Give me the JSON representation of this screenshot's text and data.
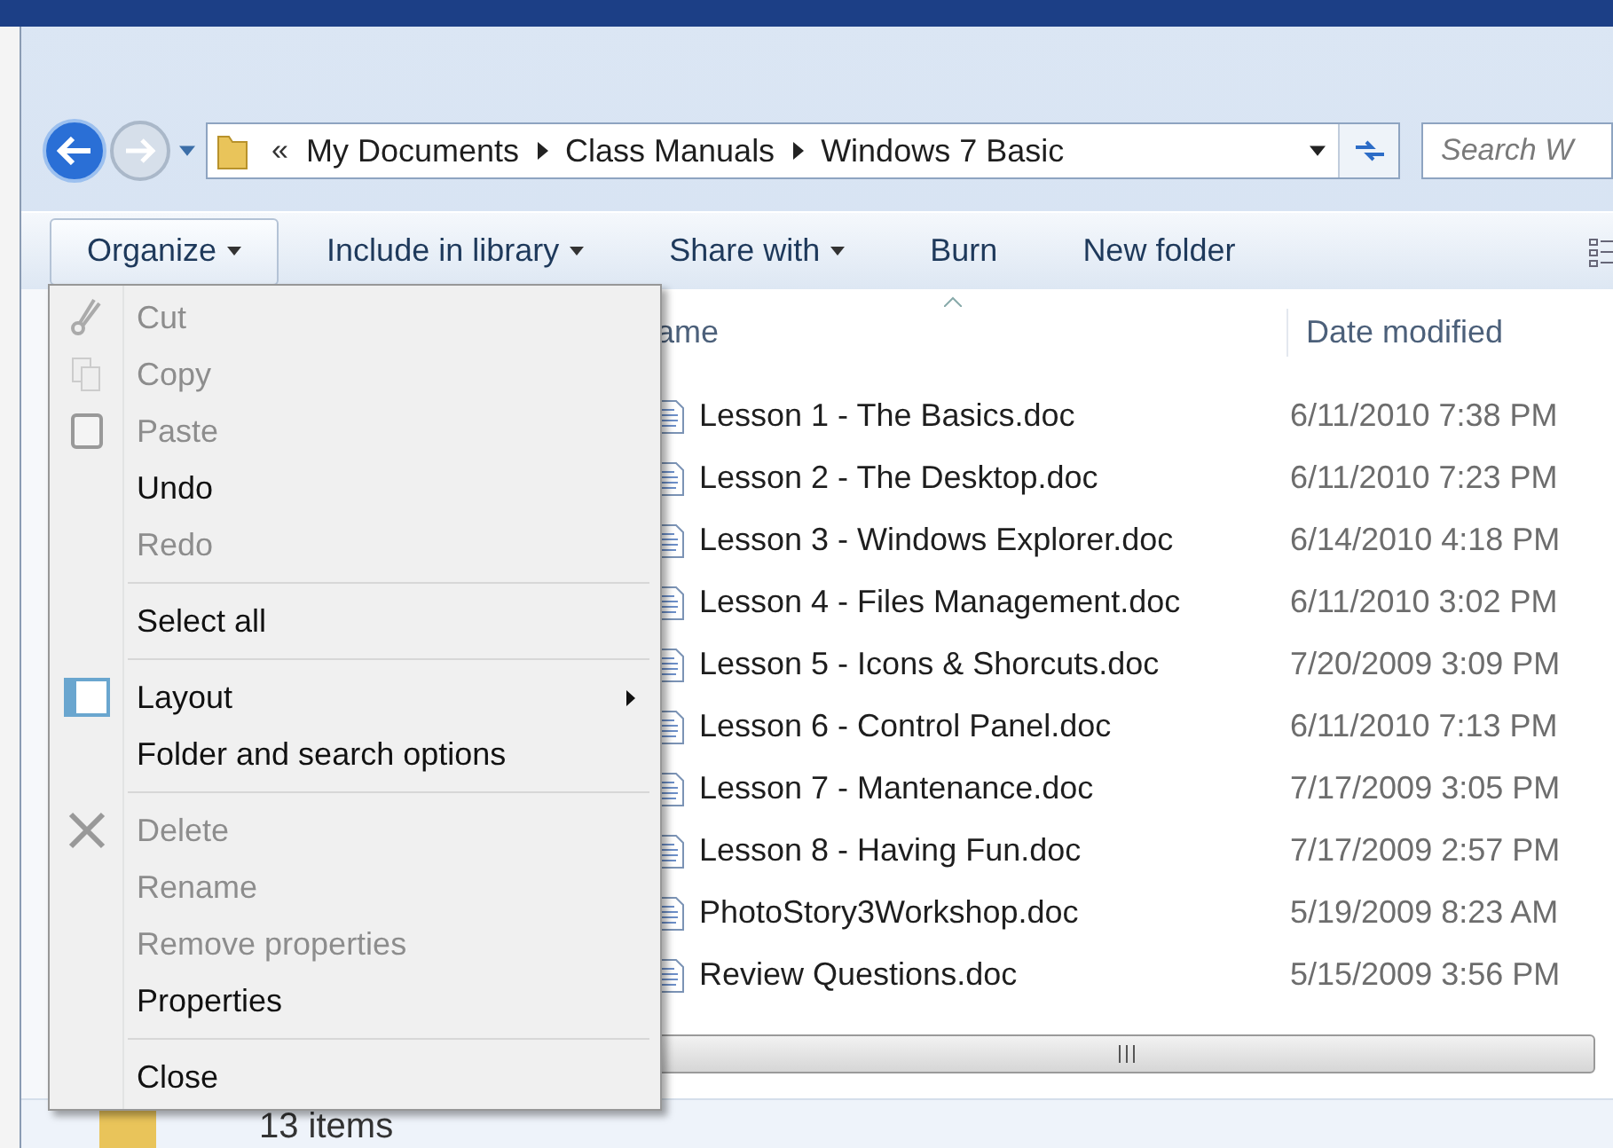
{
  "address_bar": {
    "overflow": "«",
    "path": [
      "My Documents",
      "Class Manuals",
      "Windows 7 Basic"
    ],
    "search": {
      "placeholder": "Search W"
    }
  },
  "toolbar": [
    {
      "label": "Organize",
      "has_menu": true,
      "selected": true
    },
    {
      "label": "Include in library",
      "has_menu": true,
      "selected": false
    },
    {
      "label": "Share with",
      "has_menu": true,
      "selected": false
    },
    {
      "label": "Burn",
      "has_menu": false,
      "selected": false
    },
    {
      "label": "New folder",
      "has_menu": false,
      "selected": false
    }
  ],
  "columns": [
    "ame",
    "Date modified"
  ],
  "files": [
    {
      "name": "Lesson 1 - The Basics.doc",
      "date": "6/11/2010 7:38 PM"
    },
    {
      "name": "Lesson 2 - The Desktop.doc",
      "date": "6/11/2010 7:23 PM"
    },
    {
      "name": "Lesson 3 - Windows Explorer.doc",
      "date": "6/14/2010 4:18 PM"
    },
    {
      "name": "Lesson 4 - Files Management.doc",
      "date": "6/11/2010 3:02 PM"
    },
    {
      "name": "Lesson 5 - Icons & Shorcuts.doc",
      "date": "7/20/2009 3:09 PM"
    },
    {
      "name": "Lesson 6 - Control Panel.doc",
      "date": "6/11/2010 7:13 PM"
    },
    {
      "name": "Lesson 7 - Mantenance.doc",
      "date": "7/17/2009 3:05 PM"
    },
    {
      "name": "Lesson 8 - Having Fun.doc",
      "date": "7/17/2009 2:57 PM"
    },
    {
      "name": "PhotoStory3Workshop.doc",
      "date": "5/19/2009 8:23 AM"
    },
    {
      "name": "Review Questions.doc",
      "date": "5/15/2009 3:56 PM"
    }
  ],
  "menu": [
    [
      {
        "label": "Cut",
        "disabled": true,
        "kind": "item"
      },
      {
        "label": "Copy",
        "disabled": true,
        "kind": "item"
      },
      {
        "label": "Paste",
        "disabled": true,
        "kind": "item"
      },
      {
        "label": "Undo",
        "disabled": false,
        "kind": "item"
      },
      {
        "label": "Redo",
        "disabled": true,
        "kind": "item"
      }
    ],
    [
      {
        "label": "Select all",
        "disabled": false,
        "kind": "item"
      }
    ],
    [
      {
        "label": "Layout",
        "disabled": false,
        "kind": "submenu"
      },
      {
        "label": "Folder and search options",
        "disabled": false,
        "kind": "item"
      }
    ],
    [
      {
        "label": "Delete",
        "disabled": true,
        "kind": "item"
      },
      {
        "label": "Rename",
        "disabled": true,
        "kind": "item"
      },
      {
        "label": "Remove properties",
        "disabled": true,
        "kind": "item"
      },
      {
        "label": "Properties",
        "disabled": false,
        "kind": "item"
      }
    ],
    [
      {
        "label": "Close",
        "disabled": false,
        "kind": "item"
      }
    ]
  ],
  "status_bar": {
    "count": "13 items"
  }
}
